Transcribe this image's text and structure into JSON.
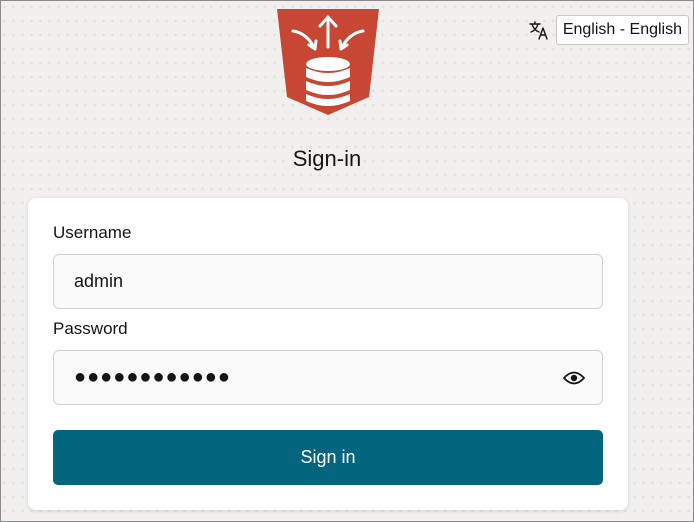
{
  "language": {
    "icon": "translate-icon",
    "selected": "English - English"
  },
  "logo": {
    "icon": "database-arrows-logo",
    "color": "#c74634"
  },
  "page": {
    "title": "Sign-in"
  },
  "form": {
    "username_label": "Username",
    "username_value": "admin",
    "password_label": "Password",
    "password_masked": "●●●●●●●●●●●●",
    "password_toggle_icon": "eye-icon",
    "submit_label": "Sign in"
  },
  "colors": {
    "button": "#04657f",
    "background": "#f1f0ee"
  }
}
